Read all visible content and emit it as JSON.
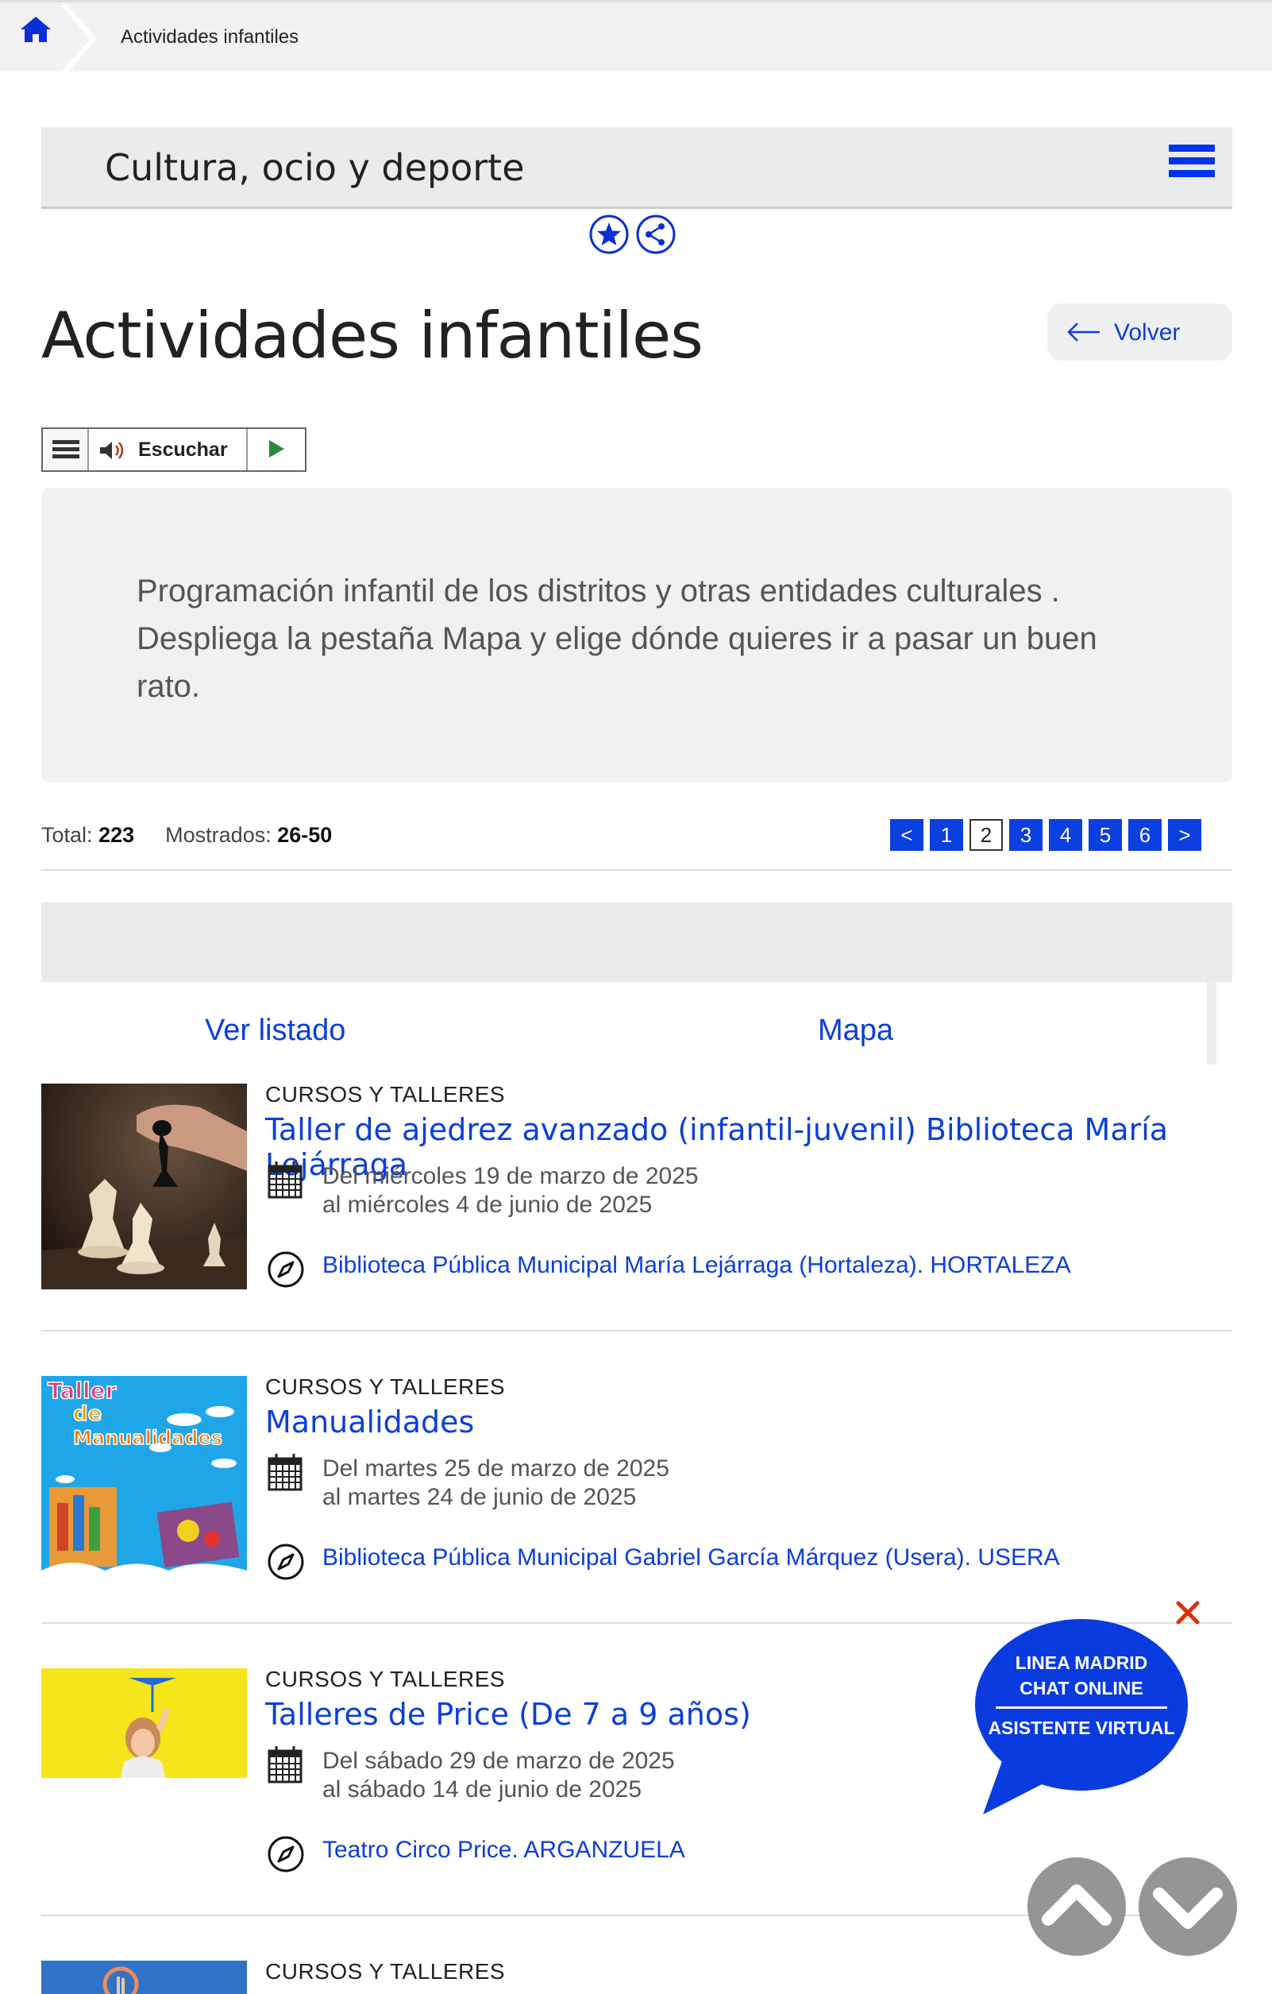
{
  "breadcrumb": {
    "current": "Actividades infantiles"
  },
  "section": {
    "title": "Cultura, ocio y deporte"
  },
  "page": {
    "title": "Actividades infantiles",
    "back_label": "Volver"
  },
  "readspeaker": {
    "label": "Escuchar"
  },
  "intro": {
    "text": "Programación infantil de los distritos y otras entidades culturales . Despliega la pestaña Mapa y elige dónde quieres ir a pasar un buen rato."
  },
  "results": {
    "total_label": "Total:",
    "total": "223",
    "shown_label": "Mostrados:",
    "shown": "26-50"
  },
  "pager": {
    "prev": "<",
    "pages": [
      "1",
      "2",
      "3",
      "4",
      "5",
      "6"
    ],
    "current": "2",
    "next": ">"
  },
  "tabs": {
    "list": "Ver listado",
    "map": "Mapa"
  },
  "items": [
    {
      "category": "CURSOS Y TALLERES",
      "title": "Taller de ajedrez avanzado (infantil-juvenil) Biblioteca María Lejárraga",
      "date_from": "Del miércoles 19 de marzo de 2025",
      "date_to": "al miércoles 4 de junio de 2025",
      "place": "Biblioteca Pública Municipal María Lejárraga (Hortaleza). HORTALEZA"
    },
    {
      "category": "CURSOS Y TALLERES",
      "title": "Manualidades",
      "date_from": "Del martes 25 de marzo de 2025",
      "date_to": "al martes 24 de junio de 2025",
      "place": "Biblioteca Pública Municipal Gabriel García Márquez (Usera). USERA",
      "thumb_text": [
        "Taller",
        "de",
        "Manualidades"
      ]
    },
    {
      "category": "CURSOS Y TALLERES",
      "title": "Talleres de Price (De 7 a 9 años)",
      "date_from": "Del sábado 29 de marzo de 2025",
      "date_to": "al sábado 14 de junio de 2025",
      "place": "Teatro Circo Price. ARGANZUELA"
    },
    {
      "category": "CURSOS Y TALLERES"
    }
  ],
  "chat": {
    "line1": "LINEA MADRID",
    "line2": "CHAT ONLINE",
    "line3": "ASISTENTE VIRTUAL"
  },
  "icons": {
    "home": "home-icon",
    "hamburger": "menu-icon",
    "favorite": "star-icon",
    "share": "share-icon",
    "back": "arrow-left-icon",
    "calendar": "calendar-icon",
    "location": "compass-icon",
    "close": "close-icon",
    "scroll_up": "chevron-up-icon",
    "scroll_down": "chevron-down-icon"
  },
  "colors": {
    "accent": "#0b3fd8",
    "pager": "#0b3fe0",
    "chat": "#0a3bdf",
    "close": "#d9300a"
  }
}
